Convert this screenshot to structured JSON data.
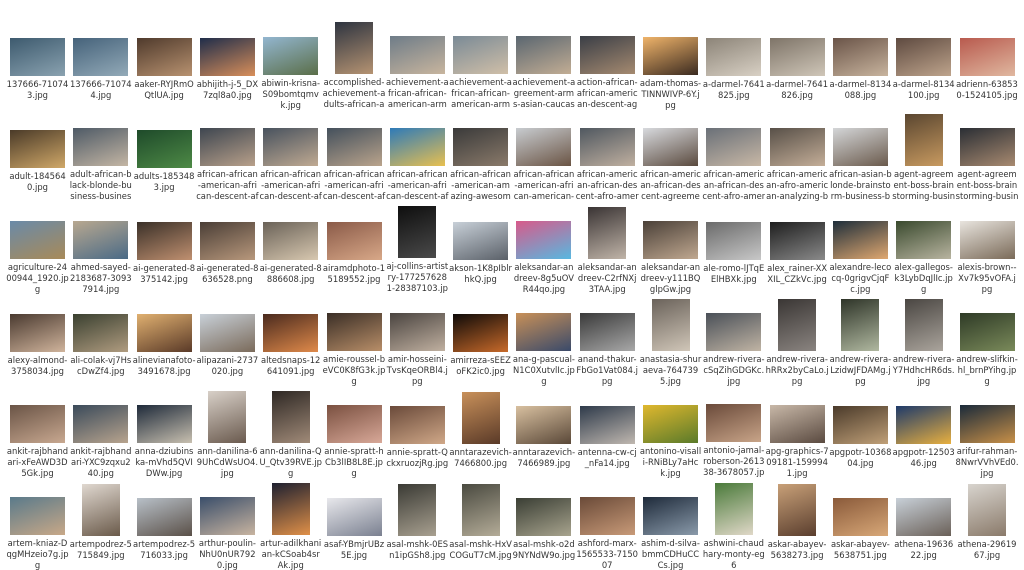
{
  "window": {
    "title": ""
  },
  "files": [
    {
      "name": "137666-710743.jpg",
      "orient": "land",
      "colors": [
        "#3d5a6e",
        "#8aa2b0"
      ]
    },
    {
      "name": "137666-710744.jpg",
      "orient": "land",
      "colors": [
        "#45627a",
        "#93aab8"
      ]
    },
    {
      "name": "aaker-RYJRmOQtlUA.jpg",
      "orient": "land",
      "colors": [
        "#4f3a2c",
        "#b89270"
      ]
    },
    {
      "name": "abhijith-j-5_DX7zql8a0.jpg",
      "orient": "land",
      "colors": [
        "#1f2d4a",
        "#d98f5a"
      ]
    },
    {
      "name": "abiwin-krisna-S09bomtqmvk.jpg",
      "orient": "land",
      "colors": [
        "#93b6d0",
        "#5a6e48"
      ]
    },
    {
      "name": "accomplished-achievement-adults-african-african-american-...",
      "orient": "port",
      "colors": [
        "#2e3440",
        "#b59372"
      ]
    },
    {
      "name": "achievement-african-african-american-arms-around-bangk...",
      "orient": "land",
      "colors": [
        "#6e7c88",
        "#c8b59e"
      ]
    },
    {
      "name": "achievement-african-african-american-arms-raised-bangko...",
      "orient": "land",
      "colors": [
        "#7a8a96",
        "#d0bfa8"
      ]
    },
    {
      "name": "achievement-agreement-arms-asian-caucasian-cheerful-144...",
      "orient": "land",
      "colors": [
        "#5a6670",
        "#c2ad94"
      ]
    },
    {
      "name": "action-african-african-american-descent-agreement-america...",
      "orient": "land",
      "colors": [
        "#3a3e46",
        "#a58a70"
      ]
    },
    {
      "name": "adam-thomas-TINNWIVP-6Y.jpg",
      "orient": "land",
      "colors": [
        "#f0b46a",
        "#3a2a20"
      ]
    },
    {
      "name": "a-darmel-7641825.jpg",
      "orient": "land",
      "colors": [
        "#8c8478",
        "#d8d0c4"
      ]
    },
    {
      "name": "a-darmel-7641826.jpg",
      "orient": "land",
      "colors": [
        "#7e7468",
        "#cfc6b8"
      ]
    },
    {
      "name": "a-darmel-8134088.jpg",
      "orient": "land",
      "colors": [
        "#6a5448",
        "#c8b49e"
      ]
    },
    {
      "name": "a-darmel-8134100.jpg",
      "orient": "land",
      "colors": [
        "#5e4a40",
        "#bea48c"
      ]
    },
    {
      "name": "adrienn-638530-1524105.jpg",
      "orient": "land",
      "colors": [
        "#b85a4e",
        "#e0b8a0"
      ]
    },
    {
      "name": "adult-1845640.jpg",
      "orient": "land",
      "colors": [
        "#4a3a28",
        "#d0a868"
      ]
    },
    {
      "name": "adult-african-black-blonde-business-businessman-1629587...",
      "orient": "land",
      "colors": [
        "#4e5a66",
        "#c4b6a4"
      ]
    },
    {
      "name": "adults-1853483.jpg",
      "orient": "land",
      "colors": [
        "#1e4a2a",
        "#4e8a46"
      ]
    },
    {
      "name": "african-african-american-african-descent-african-american-anal...",
      "orient": "land",
      "colors": [
        "#3e4650",
        "#b8a08a"
      ]
    },
    {
      "name": "african-african-american-african-descent-afro-american-anal...",
      "orient": "land",
      "colors": [
        "#48525e",
        "#c0aa92"
      ]
    },
    {
      "name": "african-african-american-african-descent-afro-american-ans...",
      "orient": "land",
      "colors": [
        "#44505c",
        "#baa48c"
      ]
    },
    {
      "name": "african-african-american-african-descent-afro-american-arm...",
      "orient": "land",
      "colors": [
        "#2e7ab8",
        "#e8c050"
      ]
    },
    {
      "name": "african-african-american-amazing-awesome-bangkok-black...",
      "orient": "land",
      "colors": [
        "#3a3a3a",
        "#8a7a6a"
      ]
    },
    {
      "name": "african-african-american-african-american-asian-bangkok-1...",
      "orient": "land",
      "colors": [
        "#c8ccd0",
        "#6a5444"
      ]
    },
    {
      "name": "african-american-african-descent-afro-american-analyzing-b...",
      "orient": "land",
      "colors": [
        "#505860",
        "#c0b0a0"
      ]
    },
    {
      "name": "african-american-african-descent-agreement-american-asian...",
      "orient": "land",
      "colors": [
        "#d8dade",
        "#5a4a3e"
      ]
    },
    {
      "name": "african-american-african-descent-afro-american-asian-black-casu...",
      "orient": "land",
      "colors": [
        "#6a7078",
        "#c8b8a6"
      ]
    },
    {
      "name": "african-american-afro-american-analyzing-black-people-br...",
      "orient": "land",
      "colors": [
        "#585048",
        "#c4ae98"
      ]
    },
    {
      "name": "african-asian-blonde-brainstorm-business-businessman-162...",
      "orient": "land",
      "colors": [
        "#d4d6d8",
        "#6a5a4c"
      ]
    },
    {
      "name": "agent-agreement-boss-brainstorming-business-businessma...",
      "orient": "port",
      "colors": [
        "#5a4630",
        "#c89a60"
      ]
    },
    {
      "name": "agent-agreement-boss-brainstorming-business-businessma...",
      "orient": "land",
      "colors": [
        "#2a2e34",
        "#a88a70"
      ]
    },
    {
      "name": "agriculture-2400944_1920.jpg",
      "orient": "land",
      "colors": [
        "#6a8aa8",
        "#a88a58"
      ]
    },
    {
      "name": "ahmed-sayed-2183687-30937914.jpg",
      "orient": "land",
      "colors": [
        "#b8a890",
        "#4a6a86"
      ]
    },
    {
      "name": "ai-generated-8375142.jpg",
      "orient": "land",
      "colors": [
        "#3a3028",
        "#c09070"
      ]
    },
    {
      "name": "ai-generated-8636528.png",
      "orient": "land",
      "colors": [
        "#4a3e36",
        "#b8987c"
      ]
    },
    {
      "name": "ai-generated-8886608.jpg",
      "orient": "land",
      "colors": [
        "#6a6258",
        "#d8c8b0"
      ]
    },
    {
      "name": "airamdphoto-15189552.jpg",
      "orient": "land",
      "colors": [
        "#8a5a48",
        "#d8a888"
      ]
    },
    {
      "name": "aj-collins-artistry-1772576281-28387103.jpg",
      "orient": "port",
      "colors": [
        "#0e0e0e",
        "#4a4a4a"
      ]
    },
    {
      "name": "akson-1K8pIblrhkQ.jpg",
      "orient": "land",
      "colors": [
        "#c8d0d8",
        "#5a6068"
      ]
    },
    {
      "name": "aleksandar-andreev-8g5uOVR44qo.jpg",
      "orient": "land",
      "colors": [
        "#d85a8a",
        "#58b8e0"
      ]
    },
    {
      "name": "aleksandar-andreev-C2rfNXj3TAA.jpg",
      "orient": "port",
      "colors": [
        "#3a3434",
        "#c0b4a8"
      ]
    },
    {
      "name": "aleksandar-andreev-y111BQglpGw.jpg",
      "orient": "land",
      "colors": [
        "#4a4038",
        "#c0a890"
      ]
    },
    {
      "name": "ale-romo-lJTqEElHBXk.jpg",
      "orient": "land",
      "colors": [
        "#6a6a6a",
        "#c8c8c8"
      ]
    },
    {
      "name": "alex_rainer-XXXIL_CZkVc.jpg",
      "orient": "land",
      "colors": [
        "#1e1e1e",
        "#8a8a8a"
      ]
    },
    {
      "name": "alexandre-lecocq-0grigvCjqFc.jpg",
      "orient": "land",
      "colors": [
        "#1e2e3a",
        "#e0a870"
      ]
    },
    {
      "name": "alex-gallegos-k3LybDqJlIc.jpg",
      "orient": "land",
      "colors": [
        "#3a4a2e",
        "#b8b4a0"
      ]
    },
    {
      "name": "alexis-brown--Xv7k95vOFA.jpg",
      "orient": "land",
      "colors": [
        "#e8e4de",
        "#7a6a58"
      ]
    },
    {
      "name": "alexy-almond-3758034.jpg",
      "orient": "land",
      "colors": [
        "#4a3a30",
        "#d0b49c"
      ]
    },
    {
      "name": "ali-colak-vj7HscDwZf4.jpg",
      "orient": "land",
      "colors": [
        "#3a4030",
        "#b09c80"
      ]
    },
    {
      "name": "alinevianafoto-3491678.jpg",
      "orient": "land",
      "colors": [
        "#e0b070",
        "#5a3a28"
      ]
    },
    {
      "name": "alipazani-2737020.jpg",
      "orient": "land",
      "colors": [
        "#c8d0d8",
        "#7a6a5a"
      ]
    },
    {
      "name": "altedsnaps-12641091.jpg",
      "orient": "land",
      "colors": [
        "#4a2a1e",
        "#e08a4a"
      ]
    },
    {
      "name": "amie-roussel-beVC0K8fG3k.jpg",
      "orient": "land",
      "colors": [
        "#3a2e26",
        "#b88e68"
      ]
    },
    {
      "name": "amir-hosseini-TvsKqeORBl4.jpg",
      "orient": "land",
      "colors": [
        "#4a4440",
        "#c0b0a0"
      ]
    },
    {
      "name": "amirreza-sEEZoFK2ic0.jpg",
      "orient": "land",
      "colors": [
        "#0e0a08",
        "#c86a2a"
      ]
    },
    {
      "name": "ana-g-pascual-N1C0XutvlIc.jpg",
      "orient": "land",
      "colors": [
        "#c89058",
        "#3a4a6a"
      ]
    },
    {
      "name": "anand-thakur-FbGo1Vat084.jpg",
      "orient": "land",
      "colors": [
        "#3a3a3a",
        "#a8a8a8"
      ]
    },
    {
      "name": "anastasia-shuraeva-7647395.jpg",
      "orient": "port",
      "colors": [
        "#6a625a",
        "#d0c6b8"
      ]
    },
    {
      "name": "andrew-rivera-cSqZihGDGKc.jpg",
      "orient": "land",
      "colors": [
        "#4a5058",
        "#c0b4a4"
      ]
    },
    {
      "name": "andrew-rivera-hRRx2byCaLo.jpg",
      "orient": "port",
      "colors": [
        "#3a3634",
        "#8a8480"
      ]
    },
    {
      "name": "andrew-rivera-LzidwJFDAMg.jpg",
      "orient": "port",
      "colors": [
        "#2e3428",
        "#b0b8a0"
      ]
    },
    {
      "name": "andrew-rivera-Y7HdhcHR6ds.jpg",
      "orient": "port",
      "colors": [
        "#4a4642",
        "#aaa49c"
      ]
    },
    {
      "name": "andrew-slifkin-hl_brnPYihg.jpg",
      "orient": "land",
      "colors": [
        "#2e3a26",
        "#7a8a5a"
      ]
    },
    {
      "name": "ankit-rajbhandari-xFeAWD3D5Gk.jpg",
      "orient": "land",
      "colors": [
        "#6a5446",
        "#c8a890"
      ]
    },
    {
      "name": "ankit-rajbhandari-YXC9zqxu240.jpg",
      "orient": "land",
      "colors": [
        "#3a4a5a",
        "#b8a48e"
      ]
    },
    {
      "name": "anna-dziubinska-mVhd5QVIDWw.jpg",
      "orient": "land",
      "colors": [
        "#1e2a3a",
        "#c8c0b0"
      ]
    },
    {
      "name": "ann-danilina-69UhCdWsUO4.jpg",
      "orient": "port",
      "colors": [
        "#d8d0c8",
        "#6a5a4e"
      ]
    },
    {
      "name": "ann-danilina-QU_Qtv39RVE.jpg",
      "orient": "port",
      "colors": [
        "#2e2824",
        "#a08a78"
      ]
    },
    {
      "name": "annie-spratt-hCb3lIB8L8E.jpg",
      "orient": "land",
      "colors": [
        "#7a5040",
        "#d8a898"
      ]
    },
    {
      "name": "annie-spratt-QckxruozjRg.jpg",
      "orient": "land",
      "colors": [
        "#6a4a3a",
        "#d0a888"
      ]
    },
    {
      "name": "anntarazevich-7466800.jpg",
      "orient": "port",
      "colors": [
        "#c8905a",
        "#5a3a28"
      ]
    },
    {
      "name": "anntarazevich-7466989.jpg",
      "orient": "land",
      "colors": [
        "#d8c0a0",
        "#5a4838"
      ]
    },
    {
      "name": "antenna-cw-cj_nFa14.jpg",
      "orient": "land",
      "colors": [
        "#2e3a4a",
        "#c0b8b0"
      ]
    },
    {
      "name": "antonino-visalli-RNiBLy7aHck.jpg",
      "orient": "land",
      "colors": [
        "#e0b82e",
        "#5a7a2a"
      ]
    },
    {
      "name": "antonio-jamal-roberson-261338-3678057.jpg",
      "orient": "land",
      "colors": [
        "#6a4a3a",
        "#c8a488"
      ]
    },
    {
      "name": "apg-graphics-709181-1599941.jpg",
      "orient": "land",
      "colors": [
        "#c8b8a8",
        "#5a4a40"
      ]
    },
    {
      "name": "apgpotr-1036804.jpg",
      "orient": "land",
      "colors": [
        "#4a3a2a",
        "#c0a078"
      ]
    },
    {
      "name": "apgpotr-1250346.jpg",
      "orient": "land",
      "colors": [
        "#1e3a6a",
        "#e8b040"
      ]
    },
    {
      "name": "arifur-rahman-8NwrVVhVEd0.jpg",
      "orient": "land",
      "colors": [
        "#1a2a3a",
        "#c89048"
      ]
    },
    {
      "name": "artem-kniaz-DqgMHzeio7g.jpg",
      "orient": "land",
      "colors": [
        "#5a7a8a",
        "#c8a888"
      ]
    },
    {
      "name": "artempodrez-5715849.jpg",
      "orient": "port",
      "colors": [
        "#e0d8d0",
        "#6a5a4a"
      ]
    },
    {
      "name": "artempodrez-5716033.jpg",
      "orient": "land",
      "colors": [
        "#b8c0c8",
        "#5a5048"
      ]
    },
    {
      "name": "arthur-poulin-NhU0nUR7920.jpg",
      "orient": "land",
      "colors": [
        "#3a4e6a",
        "#c8b4a0"
      ]
    },
    {
      "name": "artur-adilkhanian-kCSoab4srAk.jpg",
      "orient": "port",
      "colors": [
        "#1e2030",
        "#e09048"
      ]
    },
    {
      "name": "asaf-YBmjrUBz5E.jpg",
      "orient": "land",
      "colors": [
        "#e8e8ec",
        "#7a8090"
      ]
    },
    {
      "name": "asal-mshk-0ESn1ipGSh8.jpg",
      "orient": "port",
      "colors": [
        "#3a3a34",
        "#a8a090"
      ]
    },
    {
      "name": "asal-mshk-HxVCOGuT7cM.jpg",
      "orient": "port",
      "colors": [
        "#4a4a40",
        "#b4ac98"
      ]
    },
    {
      "name": "asal-mshk-o2d9NYNdW9o.jpg",
      "orient": "land",
      "colors": [
        "#3a3e34",
        "#a8a48e"
      ]
    },
    {
      "name": "ashford-marx-1565533-715007",
      "orient": "land",
      "colors": [
        "#6a4a38",
        "#c89a78"
      ]
    },
    {
      "name": "ashim-d-silva-bmmCDHuCCCs.jpg",
      "orient": "land",
      "colors": [
        "#1e2a3a",
        "#8a9aaa"
      ]
    },
    {
      "name": "ashwini-chaudhary-monty-eg6",
      "orient": "port",
      "colors": [
        "#4a7a3a",
        "#e0d8c8"
      ]
    },
    {
      "name": "askar-abayev-5638273.jpg",
      "orient": "port",
      "colors": [
        "#c8a078",
        "#5a3e2e"
      ]
    },
    {
      "name": "askar-abayev-5638751.jpg",
      "orient": "land",
      "colors": [
        "#8a5a3a",
        "#d8a878"
      ]
    },
    {
      "name": "athena-1963622.jpg",
      "orient": "land",
      "colors": [
        "#c8d0d8",
        "#6a6058"
      ]
    },
    {
      "name": "athena-2961967.jpg",
      "orient": "port",
      "colors": [
        "#d8d4ce",
        "#8a7a6a"
      ]
    }
  ]
}
